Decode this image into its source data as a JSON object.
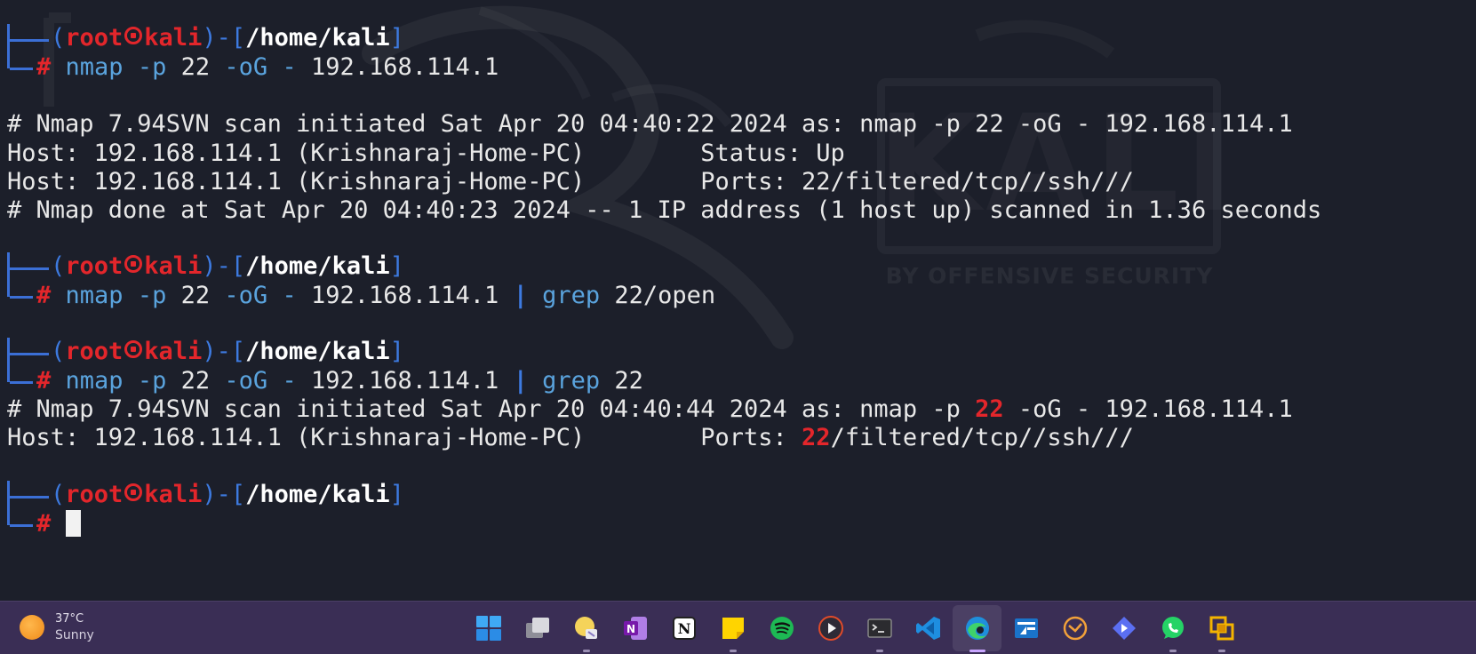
{
  "terminal": {
    "prompt": {
      "open": "(",
      "user": "root",
      "host": "kali",
      "close": ")-[",
      "path": "/home/kali",
      "end": "]",
      "hash": "#"
    },
    "blocks": [
      {
        "command": {
          "bin": "nmap",
          "flag1": "-p",
          "port": "22",
          "flag2": "-oG",
          "dash": "-",
          "ip": "192.168.114.1"
        },
        "output": [
          "# Nmap 7.94SVN scan initiated Sat Apr 20 04:40:22 2024 as: nmap -p 22 -oG - 192.168.114.1",
          "Host: 192.168.114.1 (Krishnaraj-Home-PC)\tStatus: Up",
          "Host: 192.168.114.1 (Krishnaraj-Home-PC)\tPorts: 22/filtered/tcp//ssh///",
          "# Nmap done at Sat Apr 20 04:40:23 2024 -- 1 IP address (1 host up) scanned in 1.36 seconds"
        ]
      },
      {
        "command": {
          "bin": "nmap",
          "flag1": "-p",
          "port": "22",
          "flag2": "-oG",
          "dash": "-",
          "ip": "192.168.114.1",
          "pipe": "|",
          "grep": "grep",
          "pattern": "22/open"
        }
      },
      {
        "command": {
          "bin": "nmap",
          "flag1": "-p",
          "port": "22",
          "flag2": "-oG",
          "dash": "-",
          "ip": "192.168.114.1",
          "pipe": "|",
          "grep": "grep",
          "pattern": "22"
        },
        "output_hl": [
          {
            "pre": "# Nmap 7.94SVN scan initiated Sat Apr 20 04:40:44 2024 as: nmap -p ",
            "hl": "22",
            "post": " -oG - 192.168.114.1"
          },
          {
            "pre": "Host: 192.168.114.1 (Krishnaraj-Home-PC)        Ports: ",
            "hl": "22",
            "post": "/filtered/tcp//ssh///"
          }
        ]
      }
    ]
  },
  "watermark": {
    "logo": "KALI",
    "tagline": "BY OFFENSIVE SECURITY"
  },
  "taskbar": {
    "weather": {
      "temp": "37°C",
      "condition": "Sunny"
    },
    "apps": [
      "start-icon",
      "task-view-icon",
      "file-explorer-icon",
      "onenote-icon",
      "notion-icon",
      "sticky-notes-icon",
      "spotify-icon",
      "media-player-icon",
      "terminal-icon",
      "vscode-icon",
      "edge-icon",
      "flow-icon",
      "mail-icon",
      "diamond-app-icon",
      "whatsapp-icon",
      "vmware-icon"
    ]
  },
  "colors": {
    "background": "#1c1f2a",
    "prompt_red": "#e3262b",
    "frame_blue": "#3d7ae0",
    "command_cyan": "#5aa3dd",
    "taskbar": "#3a2e55"
  }
}
